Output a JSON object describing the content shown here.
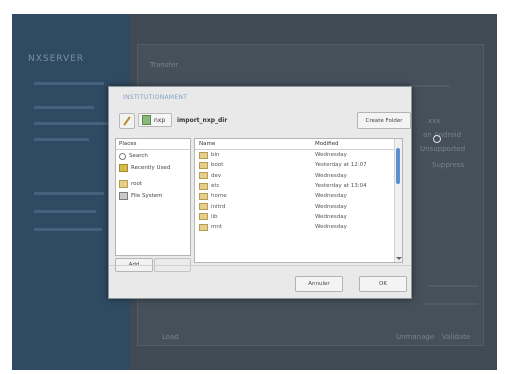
{
  "dialog": {
    "title": "INSTITUTIONAMENT",
    "path_root": "nxp",
    "path_current": "import_nxp_dir",
    "create_folder": "Create Folder",
    "places_header": "Places",
    "places": [
      {
        "label": "Search",
        "icon": "search-icon"
      },
      {
        "label": "Recently Used",
        "icon": "recent-icon"
      },
      {
        "label": "root",
        "icon": "folder-icon"
      },
      {
        "label": "File System",
        "icon": "filesystem-icon"
      }
    ],
    "add_label": "Add",
    "remove_label": "",
    "columns": {
      "name": "Name",
      "modified": "Modified"
    },
    "files": [
      {
        "name": "bin",
        "modified": "Wednesday"
      },
      {
        "name": "boot",
        "modified": "Yesterday at 12:07"
      },
      {
        "name": "dev",
        "modified": "Wednesday"
      },
      {
        "name": "etc",
        "modified": "Yesterday at 13:04"
      },
      {
        "name": "home",
        "modified": "Wednesday"
      },
      {
        "name": "initrd",
        "modified": "Wednesday"
      },
      {
        "name": "lib",
        "modified": "Wednesday"
      },
      {
        "name": "mnt",
        "modified": "Wednesday"
      }
    ],
    "cancel_label": "Annuler",
    "ok_label": "OK"
  },
  "background": {
    "logo": "NXSERVER",
    "texts": [
      "Transfer",
      "xxx",
      "an Android",
      "Unsupported",
      "Suppress",
      "Load",
      "Unmanage",
      "Validate"
    ]
  },
  "colors": {
    "accent": "#5a8fd0",
    "sidebar": "#2f4a63",
    "dialog_bg": "#e9e9e9"
  }
}
